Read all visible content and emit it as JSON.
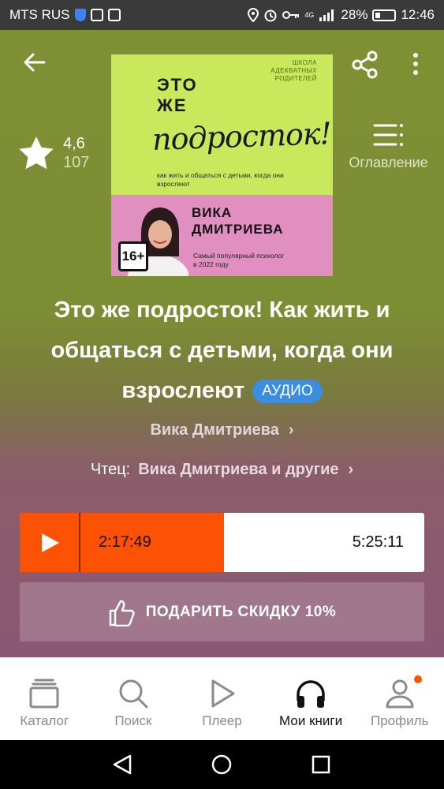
{
  "status_bar": {
    "carrier": "MTS RUS",
    "network": "4G",
    "battery": "28%",
    "time": "12:46"
  },
  "rating": {
    "value": "4,6",
    "count": "107"
  },
  "toc_label": "Оглавление",
  "cover": {
    "series": "ШКОЛА АДЕКВАТНЫХ РОДИТЕЛЕЙ",
    "title_line1": "ЭТО",
    "title_line2": "ЖЕ",
    "title_script": "подросток!",
    "subtitle": "как жить и общаться с детьми, когда они взрослеют",
    "author_line1": "ВИКА",
    "author_line2": "ДМИТРИЕВА",
    "age": "16+",
    "popular": "Самый популярный психолог в 2022 году"
  },
  "book": {
    "title": "Это же подросток! Как жить и общаться с детьми, когда они взрослеют",
    "badge": "АУДИО",
    "author": "Вика Дмитриева",
    "reader_label": "Чтец:",
    "reader": "Вика Дмитриева и другие"
  },
  "player": {
    "current_time": "2:17:49",
    "total_time": "5:25:11",
    "progress": 0.42
  },
  "gift_button": "ПОДАРИТЬ СКИДКУ 10%",
  "nav": {
    "items": [
      {
        "label": "Каталог",
        "icon": "catalog-icon",
        "active": false
      },
      {
        "label": "Поиск",
        "icon": "search-icon",
        "active": false
      },
      {
        "label": "Плеер",
        "icon": "play-icon",
        "active": false
      },
      {
        "label": "Мои книги",
        "icon": "headphones-icon",
        "active": true
      },
      {
        "label": "Профиль",
        "icon": "profile-icon",
        "active": false
      }
    ]
  },
  "colors": {
    "accent": "#fd5203",
    "badge": "#3b8de0",
    "cover_green": "#c9e85c",
    "cover_pink": "#e08fc0"
  }
}
